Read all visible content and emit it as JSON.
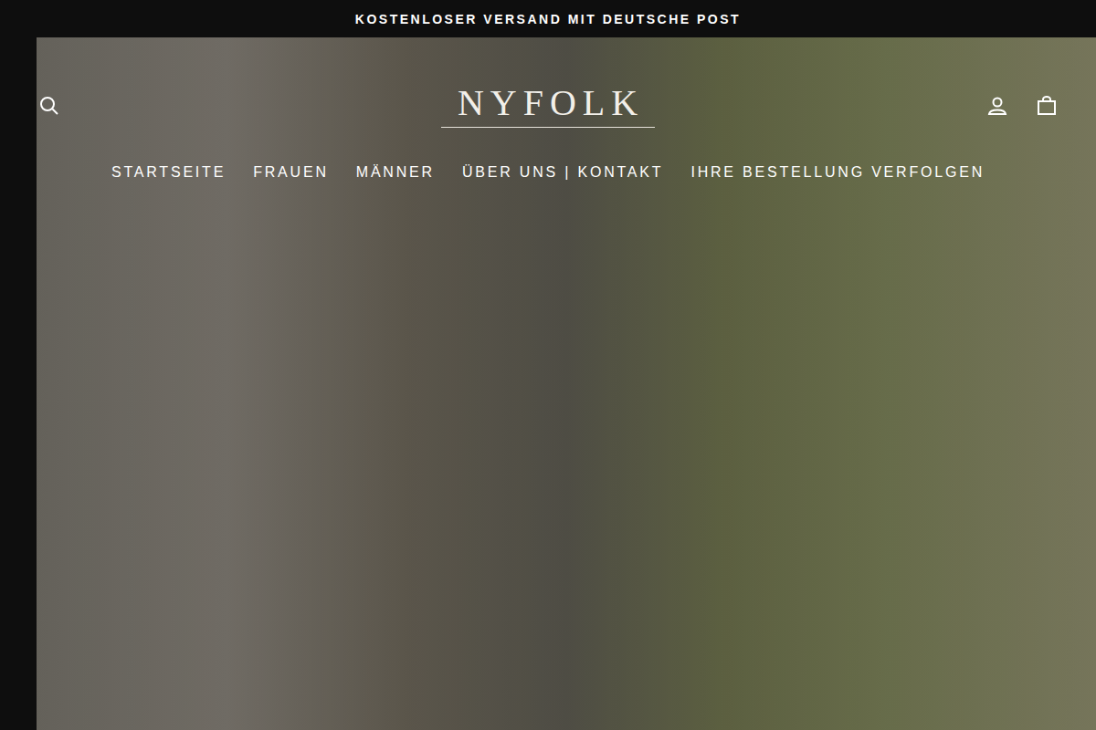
{
  "announcement": {
    "text": "KOSTENLOSER VERSAND MIT DEUTSCHE POST"
  },
  "header": {
    "logo": "NYFOLK"
  },
  "nav": {
    "items": [
      {
        "label": "STARTSEITE"
      },
      {
        "label": "FRAUEN"
      },
      {
        "label": "MÄNNER"
      },
      {
        "label": "ÜBER UNS | KONTAKT"
      },
      {
        "label": "IHRE BESTELLUNG VERFOLGEN"
      }
    ]
  }
}
